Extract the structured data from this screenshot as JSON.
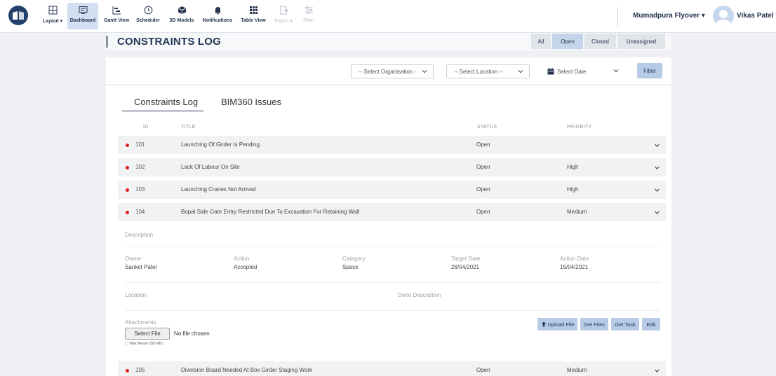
{
  "toolbar": {
    "items": [
      {
        "label": "Layout ▾",
        "icon": "layout-icon"
      },
      {
        "label": "Dashboard",
        "icon": "dashboard-icon"
      },
      {
        "label": "Gantt View",
        "icon": "gantt-icon"
      },
      {
        "label": "Scheduler",
        "icon": "clock-icon"
      },
      {
        "label": "3D Models",
        "icon": "cube-icon"
      },
      {
        "label": "Notifications",
        "icon": "bell-icon"
      },
      {
        "label": "Table View",
        "icon": "grid-icon"
      },
      {
        "label": "Export ▾",
        "icon": "export-icon"
      },
      {
        "label": "Filter",
        "icon": "filter-icon"
      }
    ],
    "project": "Mumadpura Flyover ▾",
    "user": "Vikas Patel ▾"
  },
  "page": {
    "title": "CONSTRAINTS LOG",
    "segments": [
      "All",
      "Open",
      "Closed",
      "Unassigned"
    ],
    "active_segment": "Open"
  },
  "filters": {
    "organisation": "-- Select Organisation -",
    "location": "-- Select Location --",
    "date": "Select Date",
    "button": "Filter"
  },
  "tabs": [
    "Constraints Log",
    "BIM360 Issues"
  ],
  "columns": {
    "id": "ID",
    "title": "TITLE",
    "status": "STATUS",
    "priority": "PRIORITY"
  },
  "rows": [
    {
      "id": "101",
      "title": "Launching Of Girder Is Pending",
      "status": "Open",
      "priority": ""
    },
    {
      "id": "102",
      "title": "Lack Of Labour On Site",
      "status": "Open",
      "priority": "High"
    },
    {
      "id": "103",
      "title": "Launching Cranes Not Arrived",
      "status": "Open",
      "priority": "High"
    },
    {
      "id": "104",
      "title": "Bopal Side Gate Entry Restricted Due To Excavation For Retaining Wall",
      "status": "Open",
      "priority": "Medium"
    },
    {
      "id": "105",
      "title": "Diversion Board Needed At Box Girder Staging Work",
      "status": "Open",
      "priority": "Medium"
    }
  ],
  "detail": {
    "description_label": "Description",
    "owner_label": "Owner",
    "owner": "Sanket Patel",
    "action_label": "Action",
    "action": "Accepted",
    "category_label": "Category",
    "category": "Space",
    "target_label": "Target Date",
    "target": "26/04/2021",
    "action_date_label": "Action Date",
    "action_date": "15/04/2021",
    "location_label": "Location",
    "done_label": "Done Description",
    "attachments_label": "Attachments",
    "select_file": "Select File",
    "no_file": "No file chosen",
    "max_hint": "[ * Max filesize 250 MB ]",
    "buttons": [
      "Upload File",
      "Get Files",
      "Get Task",
      "Edit"
    ]
  }
}
